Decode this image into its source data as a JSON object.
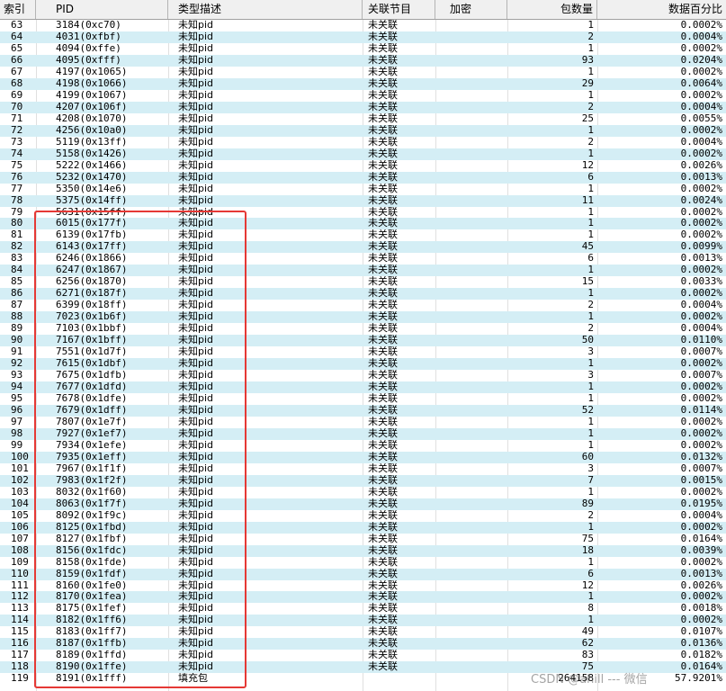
{
  "columns": {
    "index": "索引",
    "pid": "PID",
    "type": "类型描述",
    "program": "关联节目",
    "encrypted": "加密",
    "packets": "包数量",
    "percent": "数据百分比"
  },
  "rows": [
    {
      "index": "63",
      "pid": "3184(0xc70)",
      "type": "未知pid",
      "program": "未关联",
      "encrypted": "",
      "packets": "1",
      "percent": "0.0002%"
    },
    {
      "index": "64",
      "pid": "4031(0xfbf)",
      "type": "未知pid",
      "program": "未关联",
      "encrypted": "",
      "packets": "2",
      "percent": "0.0004%"
    },
    {
      "index": "65",
      "pid": "4094(0xffe)",
      "type": "未知pid",
      "program": "未关联",
      "encrypted": "",
      "packets": "1",
      "percent": "0.0002%"
    },
    {
      "index": "66",
      "pid": "4095(0xfff)",
      "type": "未知pid",
      "program": "未关联",
      "encrypted": "",
      "packets": "93",
      "percent": "0.0204%"
    },
    {
      "index": "67",
      "pid": "4197(0x1065)",
      "type": "未知pid",
      "program": "未关联",
      "encrypted": "",
      "packets": "1",
      "percent": "0.0002%"
    },
    {
      "index": "68",
      "pid": "4198(0x1066)",
      "type": "未知pid",
      "program": "未关联",
      "encrypted": "",
      "packets": "29",
      "percent": "0.0064%"
    },
    {
      "index": "69",
      "pid": "4199(0x1067)",
      "type": "未知pid",
      "program": "未关联",
      "encrypted": "",
      "packets": "1",
      "percent": "0.0002%"
    },
    {
      "index": "70",
      "pid": "4207(0x106f)",
      "type": "未知pid",
      "program": "未关联",
      "encrypted": "",
      "packets": "2",
      "percent": "0.0004%"
    },
    {
      "index": "71",
      "pid": "4208(0x1070)",
      "type": "未知pid",
      "program": "未关联",
      "encrypted": "",
      "packets": "25",
      "percent": "0.0055%"
    },
    {
      "index": "72",
      "pid": "4256(0x10a0)",
      "type": "未知pid",
      "program": "未关联",
      "encrypted": "",
      "packets": "1",
      "percent": "0.0002%"
    },
    {
      "index": "73",
      "pid": "5119(0x13ff)",
      "type": "未知pid",
      "program": "未关联",
      "encrypted": "",
      "packets": "2",
      "percent": "0.0004%"
    },
    {
      "index": "74",
      "pid": "5158(0x1426)",
      "type": "未知pid",
      "program": "未关联",
      "encrypted": "",
      "packets": "1",
      "percent": "0.0002%"
    },
    {
      "index": "75",
      "pid": "5222(0x1466)",
      "type": "未知pid",
      "program": "未关联",
      "encrypted": "",
      "packets": "12",
      "percent": "0.0026%"
    },
    {
      "index": "76",
      "pid": "5232(0x1470)",
      "type": "未知pid",
      "program": "未关联",
      "encrypted": "",
      "packets": "6",
      "percent": "0.0013%"
    },
    {
      "index": "77",
      "pid": "5350(0x14e6)",
      "type": "未知pid",
      "program": "未关联",
      "encrypted": "",
      "packets": "1",
      "percent": "0.0002%"
    },
    {
      "index": "78",
      "pid": "5375(0x14ff)",
      "type": "未知pid",
      "program": "未关联",
      "encrypted": "",
      "packets": "11",
      "percent": "0.0024%"
    },
    {
      "index": "79",
      "pid": "5631(0x15ff)",
      "type": "未知pid",
      "program": "未关联",
      "encrypted": "",
      "packets": "1",
      "percent": "0.0002%"
    },
    {
      "index": "80",
      "pid": "6015(0x177f)",
      "type": "未知pid",
      "program": "未关联",
      "encrypted": "",
      "packets": "1",
      "percent": "0.0002%"
    },
    {
      "index": "81",
      "pid": "6139(0x17fb)",
      "type": "未知pid",
      "program": "未关联",
      "encrypted": "",
      "packets": "1",
      "percent": "0.0002%"
    },
    {
      "index": "82",
      "pid": "6143(0x17ff)",
      "type": "未知pid",
      "program": "未关联",
      "encrypted": "",
      "packets": "45",
      "percent": "0.0099%"
    },
    {
      "index": "83",
      "pid": "6246(0x1866)",
      "type": "未知pid",
      "program": "未关联",
      "encrypted": "",
      "packets": "6",
      "percent": "0.0013%"
    },
    {
      "index": "84",
      "pid": "6247(0x1867)",
      "type": "未知pid",
      "program": "未关联",
      "encrypted": "",
      "packets": "1",
      "percent": "0.0002%"
    },
    {
      "index": "85",
      "pid": "6256(0x1870)",
      "type": "未知pid",
      "program": "未关联",
      "encrypted": "",
      "packets": "15",
      "percent": "0.0033%"
    },
    {
      "index": "86",
      "pid": "6271(0x187f)",
      "type": "未知pid",
      "program": "未关联",
      "encrypted": "",
      "packets": "1",
      "percent": "0.0002%"
    },
    {
      "index": "87",
      "pid": "6399(0x18ff)",
      "type": "未知pid",
      "program": "未关联",
      "encrypted": "",
      "packets": "2",
      "percent": "0.0004%"
    },
    {
      "index": "88",
      "pid": "7023(0x1b6f)",
      "type": "未知pid",
      "program": "未关联",
      "encrypted": "",
      "packets": "1",
      "percent": "0.0002%"
    },
    {
      "index": "89",
      "pid": "7103(0x1bbf)",
      "type": "未知pid",
      "program": "未关联",
      "encrypted": "",
      "packets": "2",
      "percent": "0.0004%"
    },
    {
      "index": "90",
      "pid": "7167(0x1bff)",
      "type": "未知pid",
      "program": "未关联",
      "encrypted": "",
      "packets": "50",
      "percent": "0.0110%"
    },
    {
      "index": "91",
      "pid": "7551(0x1d7f)",
      "type": "未知pid",
      "program": "未关联",
      "encrypted": "",
      "packets": "3",
      "percent": "0.0007%"
    },
    {
      "index": "92",
      "pid": "7615(0x1dbf)",
      "type": "未知pid",
      "program": "未关联",
      "encrypted": "",
      "packets": "1",
      "percent": "0.0002%"
    },
    {
      "index": "93",
      "pid": "7675(0x1dfb)",
      "type": "未知pid",
      "program": "未关联",
      "encrypted": "",
      "packets": "3",
      "percent": "0.0007%"
    },
    {
      "index": "94",
      "pid": "7677(0x1dfd)",
      "type": "未知pid",
      "program": "未关联",
      "encrypted": "",
      "packets": "1",
      "percent": "0.0002%"
    },
    {
      "index": "95",
      "pid": "7678(0x1dfe)",
      "type": "未知pid",
      "program": "未关联",
      "encrypted": "",
      "packets": "1",
      "percent": "0.0002%"
    },
    {
      "index": "96",
      "pid": "7679(0x1dff)",
      "type": "未知pid",
      "program": "未关联",
      "encrypted": "",
      "packets": "52",
      "percent": "0.0114%"
    },
    {
      "index": "97",
      "pid": "7807(0x1e7f)",
      "type": "未知pid",
      "program": "未关联",
      "encrypted": "",
      "packets": "1",
      "percent": "0.0002%"
    },
    {
      "index": "98",
      "pid": "7927(0x1ef7)",
      "type": "未知pid",
      "program": "未关联",
      "encrypted": "",
      "packets": "1",
      "percent": "0.0002%"
    },
    {
      "index": "99",
      "pid": "7934(0x1efe)",
      "type": "未知pid",
      "program": "未关联",
      "encrypted": "",
      "packets": "1",
      "percent": "0.0002%"
    },
    {
      "index": "100",
      "pid": "7935(0x1eff)",
      "type": "未知pid",
      "program": "未关联",
      "encrypted": "",
      "packets": "60",
      "percent": "0.0132%"
    },
    {
      "index": "101",
      "pid": "7967(0x1f1f)",
      "type": "未知pid",
      "program": "未关联",
      "encrypted": "",
      "packets": "3",
      "percent": "0.0007%"
    },
    {
      "index": "102",
      "pid": "7983(0x1f2f)",
      "type": "未知pid",
      "program": "未关联",
      "encrypted": "",
      "packets": "7",
      "percent": "0.0015%"
    },
    {
      "index": "103",
      "pid": "8032(0x1f60)",
      "type": "未知pid",
      "program": "未关联",
      "encrypted": "",
      "packets": "1",
      "percent": "0.0002%"
    },
    {
      "index": "104",
      "pid": "8063(0x1f7f)",
      "type": "未知pid",
      "program": "未关联",
      "encrypted": "",
      "packets": "89",
      "percent": "0.0195%"
    },
    {
      "index": "105",
      "pid": "8092(0x1f9c)",
      "type": "未知pid",
      "program": "未关联",
      "encrypted": "",
      "packets": "2",
      "percent": "0.0004%"
    },
    {
      "index": "106",
      "pid": "8125(0x1fbd)",
      "type": "未知pid",
      "program": "未关联",
      "encrypted": "",
      "packets": "1",
      "percent": "0.0002%"
    },
    {
      "index": "107",
      "pid": "8127(0x1fbf)",
      "type": "未知pid",
      "program": "未关联",
      "encrypted": "",
      "packets": "75",
      "percent": "0.0164%"
    },
    {
      "index": "108",
      "pid": "8156(0x1fdc)",
      "type": "未知pid",
      "program": "未关联",
      "encrypted": "",
      "packets": "18",
      "percent": "0.0039%"
    },
    {
      "index": "109",
      "pid": "8158(0x1fde)",
      "type": "未知pid",
      "program": "未关联",
      "encrypted": "",
      "packets": "1",
      "percent": "0.0002%"
    },
    {
      "index": "110",
      "pid": "8159(0x1fdf)",
      "type": "未知pid",
      "program": "未关联",
      "encrypted": "",
      "packets": "6",
      "percent": "0.0013%"
    },
    {
      "index": "111",
      "pid": "8160(0x1fe0)",
      "type": "未知pid",
      "program": "未关联",
      "encrypted": "",
      "packets": "12",
      "percent": "0.0026%"
    },
    {
      "index": "112",
      "pid": "8170(0x1fea)",
      "type": "未知pid",
      "program": "未关联",
      "encrypted": "",
      "packets": "1",
      "percent": "0.0002%"
    },
    {
      "index": "113",
      "pid": "8175(0x1fef)",
      "type": "未知pid",
      "program": "未关联",
      "encrypted": "",
      "packets": "8",
      "percent": "0.0018%"
    },
    {
      "index": "114",
      "pid": "8182(0x1ff6)",
      "type": "未知pid",
      "program": "未关联",
      "encrypted": "",
      "packets": "1",
      "percent": "0.0002%"
    },
    {
      "index": "115",
      "pid": "8183(0x1ff7)",
      "type": "未知pid",
      "program": "未关联",
      "encrypted": "",
      "packets": "49",
      "percent": "0.0107%"
    },
    {
      "index": "116",
      "pid": "8187(0x1ffb)",
      "type": "未知pid",
      "program": "未关联",
      "encrypted": "",
      "packets": "62",
      "percent": "0.0136%"
    },
    {
      "index": "117",
      "pid": "8189(0x1ffd)",
      "type": "未知pid",
      "program": "未关联",
      "encrypted": "",
      "packets": "83",
      "percent": "0.0182%"
    },
    {
      "index": "118",
      "pid": "8190(0x1ffe)",
      "type": "未知pid",
      "program": "未关联",
      "encrypted": "",
      "packets": "75",
      "percent": "0.0164%"
    },
    {
      "index": "119",
      "pid": "8191(0x1fff)",
      "type": "填充包",
      "program": "",
      "encrypted": "",
      "packets": "264158",
      "percent": "57.9201%"
    }
  ],
  "watermark": "CSDN @ahill --- 微信",
  "colors": {
    "alt_row": "#d4eef5",
    "highlight": "#e53935",
    "header_bg": "#f0f0f0"
  }
}
